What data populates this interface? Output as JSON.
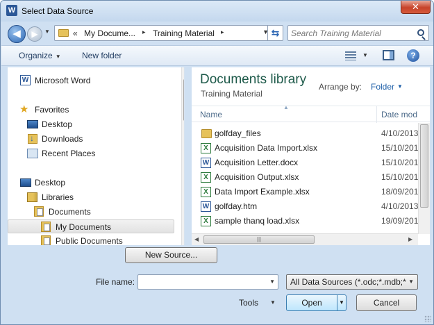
{
  "window": {
    "title": "Select Data Source",
    "app_icon_letter": "W",
    "close_label": "✕"
  },
  "address": {
    "breadcrumb_prefix": "«",
    "crumbs": [
      "My Docume...",
      "Training Material"
    ],
    "separator": "▸",
    "search_placeholder": "Search Training Material"
  },
  "toolbar": {
    "organize_label": "Organize",
    "new_folder_label": "New folder",
    "help_label": "?"
  },
  "nav": {
    "items": [
      {
        "label": "Microsoft Word",
        "icon": "word-icon"
      },
      {
        "label": "Favorites",
        "icon": "star-icon"
      },
      {
        "label": "Desktop",
        "icon": "desktop-icon"
      },
      {
        "label": "Downloads",
        "icon": "downloads-icon"
      },
      {
        "label": "Recent Places",
        "icon": "recent-places-icon"
      },
      {
        "label": "Desktop",
        "icon": "desktop-icon"
      },
      {
        "label": "Libraries",
        "icon": "libraries-icon"
      },
      {
        "label": "Documents",
        "icon": "documents-icon"
      },
      {
        "label": "My Documents",
        "icon": "folder-icon"
      },
      {
        "label": "Public Documents",
        "icon": "folder-icon"
      }
    ],
    "selected": "My Documents"
  },
  "content": {
    "library_title": "Documents library",
    "library_subtitle": "Training Material",
    "arrange_label": "Arrange by:",
    "arrange_value": "Folder",
    "column_name": "Name",
    "column_date": "Date mod",
    "files": [
      {
        "name": "golfday_files",
        "date": "4/10/2013",
        "icon": "folder-icon"
      },
      {
        "name": "Acquisition Data Import.xlsx",
        "date": "15/10/201",
        "icon": "excel-icon"
      },
      {
        "name": "Acquisition Letter.docx",
        "date": "15/10/201",
        "icon": "word-doc-icon"
      },
      {
        "name": "Acquisition Output.xlsx",
        "date": "15/10/201",
        "icon": "excel-icon"
      },
      {
        "name": "Data Import Example.xlsx",
        "date": "18/09/201",
        "icon": "excel-icon"
      },
      {
        "name": "golfday.htm",
        "date": "4/10/2013",
        "icon": "word-doc-icon"
      },
      {
        "name": "sample thanq load.xlsx",
        "date": "19/09/201",
        "icon": "excel-icon"
      }
    ]
  },
  "bottom": {
    "new_source_label": "New Source...",
    "file_name_label": "File name:",
    "file_name_value": "",
    "file_type_value": "All Data Sources (*.odc;*.mdb;*",
    "tools_label": "Tools",
    "open_label": "Open",
    "cancel_label": "Cancel"
  },
  "colors": {
    "library_title": "#1e5a4a",
    "arrange_value": "#1e5fa8",
    "window_chrome": "#cfe0f2"
  }
}
